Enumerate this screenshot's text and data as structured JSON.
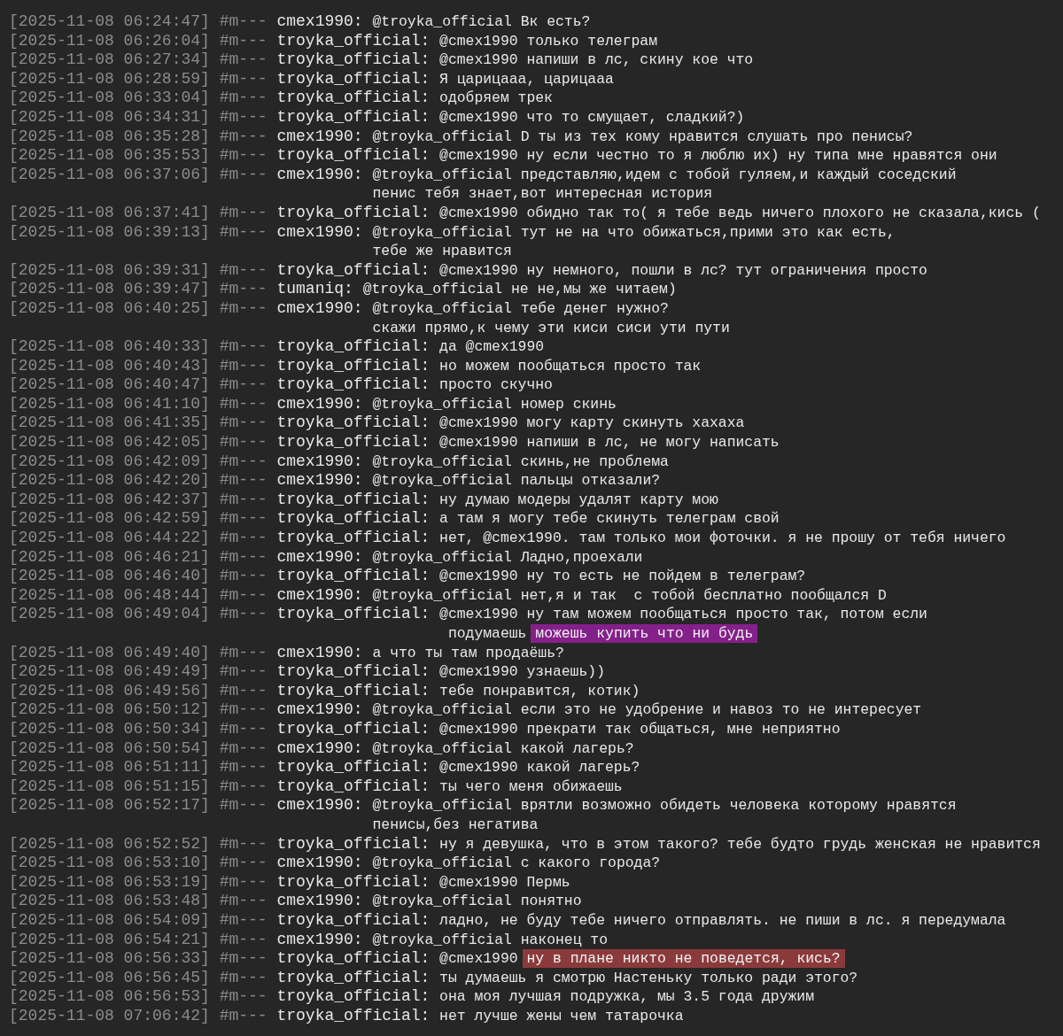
{
  "messages": [
    {
      "time": "[2025-11-08 06:24:47]",
      "channel": "#m---",
      "user": "cmex1990:",
      "lines": [
        "@troyka_official Вк есть?"
      ]
    },
    {
      "time": "[2025-11-08 06:26:04]",
      "channel": "#m---",
      "user": "troyka_official:",
      "lines": [
        "@cmex1990 только телеграм"
      ]
    },
    {
      "time": "[2025-11-08 06:27:34]",
      "channel": "#m---",
      "user": "troyka_official:",
      "lines": [
        "@cmex1990 напиши в лс, скину кое что"
      ]
    },
    {
      "time": "[2025-11-08 06:28:59]",
      "channel": "#m---",
      "user": "troyka_official:",
      "lines": [
        "Я царицааа, царицааа"
      ]
    },
    {
      "time": "[2025-11-08 06:33:04]",
      "channel": "#m---",
      "user": "troyka_official:",
      "lines": [
        "одобряем трек"
      ]
    },
    {
      "time": "[2025-11-08 06:34:31]",
      "channel": "#m---",
      "user": "troyka_official:",
      "lines": [
        "@cmex1990 что то смущает, сладкий?)"
      ]
    },
    {
      "time": "[2025-11-08 06:35:28]",
      "channel": "#m---",
      "user": "cmex1990:",
      "lines": [
        "@troyka_official D ты из тех кому нравится слушать про пенисы?"
      ]
    },
    {
      "time": "[2025-11-08 06:35:53]",
      "channel": "#m---",
      "user": "troyka_official:",
      "lines": [
        "@cmex1990 ну если честно то я люблю их) ну типа мне нравятся они"
      ]
    },
    {
      "time": "[2025-11-08 06:37:06]",
      "channel": "#m---",
      "user": "cmex1990:",
      "lines": [
        "@troyka_official представляю,идем с тобой гуляем,и каждый соседский",
        "пенис тебя знает,вот интересная история"
      ]
    },
    {
      "time": "[2025-11-08 06:37:41]",
      "channel": "#m---",
      "user": "troyka_official:",
      "lines": [
        "@cmex1990 обидно так то( я тебе ведь ничего плохого не сказала,кись ("
      ]
    },
    {
      "time": "[2025-11-08 06:39:13]",
      "channel": "#m---",
      "user": "cmex1990:",
      "lines": [
        "@troyka_official тут не на что обижаться,прими это как есть,",
        "тебе же нравится"
      ]
    },
    {
      "time": "[2025-11-08 06:39:31]",
      "channel": "#m---",
      "user": "troyka_official:",
      "lines": [
        "@cmex1990 ну немного, пошли в лс? тут ограничения просто"
      ]
    },
    {
      "time": "[2025-11-08 06:39:47]",
      "channel": "#m---",
      "user": "tumaniq:",
      "lines": [
        "@troyka_official не не,мы же читаем)"
      ]
    },
    {
      "time": "[2025-11-08 06:40:25]",
      "channel": "#m---",
      "user": "cmex1990:",
      "lines": [
        "@troyka_official тебе денег нужно?",
        "скажи прямо,к чему эти киси сиси ути пути"
      ]
    },
    {
      "time": "[2025-11-08 06:40:33]",
      "channel": "#m---",
      "user": "troyka_official:",
      "lines": [
        "да @cmex1990"
      ]
    },
    {
      "time": "[2025-11-08 06:40:43]",
      "channel": "#m---",
      "user": "troyka_official:",
      "lines": [
        "но можем пообщаться просто так"
      ]
    },
    {
      "time": "[2025-11-08 06:40:47]",
      "channel": "#m---",
      "user": "troyka_official:",
      "lines": [
        "просто скучно"
      ]
    },
    {
      "time": "[2025-11-08 06:41:10]",
      "channel": "#m---",
      "user": "cmex1990:",
      "lines": [
        "@troyka_official номер скинь"
      ]
    },
    {
      "time": "[2025-11-08 06:41:35]",
      "channel": "#m---",
      "user": "troyka_official:",
      "lines": [
        "@cmex1990 могу карту скинуть хахаха"
      ]
    },
    {
      "time": "[2025-11-08 06:42:05]",
      "channel": "#m---",
      "user": "troyka_official:",
      "lines": [
        "@cmex1990 напиши в лс, не могу написать"
      ]
    },
    {
      "time": "[2025-11-08 06:42:09]",
      "channel": "#m---",
      "user": "cmex1990:",
      "lines": [
        "@troyka_official скинь,не проблема"
      ]
    },
    {
      "time": "[2025-11-08 06:42:20]",
      "channel": "#m---",
      "user": "cmex1990:",
      "lines": [
        "@troyka_official пальцы отказали?"
      ]
    },
    {
      "time": "[2025-11-08 06:42:37]",
      "channel": "#m---",
      "user": "troyka_official:",
      "lines": [
        "ну думаю модеры удалят карту мою"
      ]
    },
    {
      "time": "[2025-11-08 06:42:59]",
      "channel": "#m---",
      "user": "troyka_official:",
      "lines": [
        "а там я могу тебе скинуть телеграм свой"
      ]
    },
    {
      "time": "[2025-11-08 06:44:22]",
      "channel": "#m---",
      "user": "troyka_official:",
      "lines": [
        "нет, @cmex1990. там только мои фоточки. я не прошу от тебя ничего"
      ]
    },
    {
      "time": "[2025-11-08 06:46:21]",
      "channel": "#m---",
      "user": "cmex1990:",
      "lines": [
        "@troyka_official Ладно,проехали"
      ]
    },
    {
      "time": "[2025-11-08 06:46:40]",
      "channel": "#m---",
      "user": "troyka_official:",
      "lines": [
        "@cmex1990 ну то есть не пойдем в телеграм?"
      ]
    },
    {
      "time": "[2025-11-08 06:48:44]",
      "channel": "#m---",
      "user": "cmex1990:",
      "lines": [
        "@troyka_official нет,я и так  с тобой бесплатно пообщался D"
      ]
    },
    {
      "time": "[2025-11-08 06:49:04]",
      "channel": "#m---",
      "user": "troyka_official:",
      "lines": [
        "@cmex1990 ну там можем пообщаться просто так, потом если",
        " подумаешь"
      ],
      "highlight": {
        "text": "можешь купить что ни будь",
        "color": "#84208a"
      }
    },
    {
      "time": "[2025-11-08 06:49:40]",
      "channel": "#m---",
      "user": "cmex1990:",
      "lines": [
        "а что ты там продаёшь?"
      ]
    },
    {
      "time": "[2025-11-08 06:49:49]",
      "channel": "#m---",
      "user": "troyka_official:",
      "lines": [
        "@cmex1990 узнаешь))"
      ]
    },
    {
      "time": "[2025-11-08 06:49:56]",
      "channel": "#m---",
      "user": "troyka_official:",
      "lines": [
        "тебе понравится, котик)"
      ]
    },
    {
      "time": "[2025-11-08 06:50:12]",
      "channel": "#m---",
      "user": "cmex1990:",
      "lines": [
        "@troyka_official если это не удобрение и навоз то не интересует"
      ]
    },
    {
      "time": "[2025-11-08 06:50:34]",
      "channel": "#m---",
      "user": "troyka_official:",
      "lines": [
        "@cmex1990 прекрати так общаться, мне неприятно"
      ]
    },
    {
      "time": "[2025-11-08 06:50:54]",
      "channel": "#m---",
      "user": "cmex1990:",
      "lines": [
        "@troyka_official какой лагерь?"
      ]
    },
    {
      "time": "[2025-11-08 06:51:11]",
      "channel": "#m---",
      "user": "troyka_official:",
      "lines": [
        "@cmex1990 какой лагерь?"
      ]
    },
    {
      "time": "[2025-11-08 06:51:15]",
      "channel": "#m---",
      "user": "troyka_official:",
      "lines": [
        "ты чего меня обижаешь"
      ]
    },
    {
      "time": "[2025-11-08 06:52:17]",
      "channel": "#m---",
      "user": "cmex1990:",
      "lines": [
        "@troyka_official врятли возможно обидеть человека которому нравятся",
        "пенисы,без негатива"
      ]
    },
    {
      "time": "[2025-11-08 06:52:52]",
      "channel": "#m---",
      "user": "troyka_official:",
      "lines": [
        "ну я девушка, что в этом такого? тебе будто грудь женская не нравится"
      ]
    },
    {
      "time": "[2025-11-08 06:53:10]",
      "channel": "#m---",
      "user": "cmex1990:",
      "lines": [
        "@troyka_official с какого города?"
      ]
    },
    {
      "time": "[2025-11-08 06:53:19]",
      "channel": "#m---",
      "user": "troyka_official:",
      "lines": [
        "@cmex1990 Пермь"
      ]
    },
    {
      "time": "[2025-11-08 06:53:48]",
      "channel": "#m---",
      "user": "cmex1990:",
      "lines": [
        "@troyka_official понятно"
      ]
    },
    {
      "time": "[2025-11-08 06:54:09]",
      "channel": "#m---",
      "user": "troyka_official:",
      "lines": [
        "ладно, не буду тебе ничего отправлять. не пиши в лс. я передумала"
      ]
    },
    {
      "time": "[2025-11-08 06:54:21]",
      "channel": "#m---",
      "user": "cmex1990:",
      "lines": [
        "@troyka_official наконец то"
      ]
    },
    {
      "time": "[2025-11-08 06:56:33]",
      "channel": "#m---",
      "user": "troyka_official:",
      "lines": [
        "@cmex1990"
      ],
      "highlight": {
        "text": "ну в плане никто не поведется, кись?",
        "color": "#8b3a3c"
      }
    },
    {
      "time": "[2025-11-08 06:56:45]",
      "channel": "#m---",
      "user": "troyka_official:",
      "lines": [
        "ты думаешь я смотрю Настеньку только ради этого?"
      ]
    },
    {
      "time": "[2025-11-08 06:56:53]",
      "channel": "#m---",
      "user": "troyka_official:",
      "lines": [
        "она моя лучшая подружка, мы 3.5 года дружим"
      ]
    },
    {
      "time": "[2025-11-08 07:06:42]",
      "channel": "#m---",
      "user": "troyka_official:",
      "lines": [
        "нет лучше жены чем татарочка"
      ]
    }
  ]
}
